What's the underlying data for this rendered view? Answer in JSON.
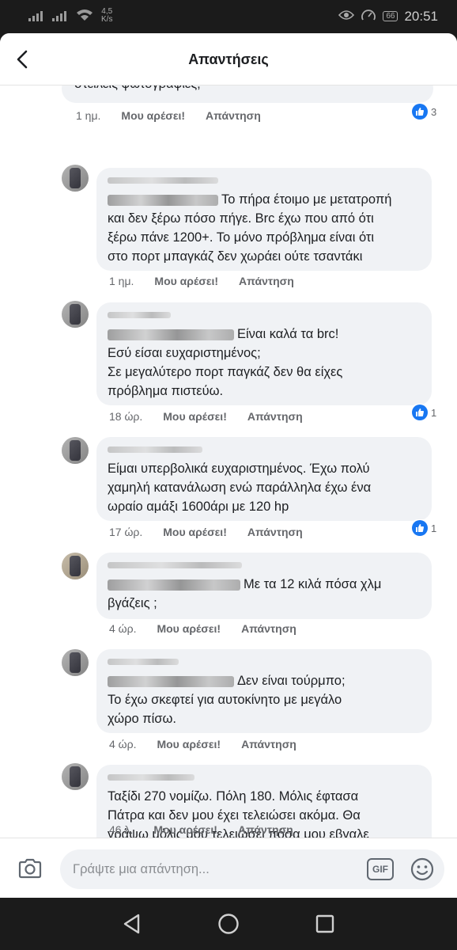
{
  "status_bar": {
    "network_speed_value": "4,5",
    "network_speed_unit": "K/s",
    "battery": "66",
    "time": "20:51",
    "icons": [
      "signal-icon",
      "signal-icon",
      "wifi-icon",
      "eye-icon",
      "speedometer-icon",
      "battery-icon"
    ]
  },
  "header": {
    "title": "Απαντήσεις",
    "back_icon": "back-arrow-icon"
  },
  "actions": {
    "like": "Μου αρέσει!",
    "reply": "Απάντηση"
  },
  "comments": [
    {
      "text_lines": [
        "στείλεις φωτογραφίες;"
      ],
      "time": "1 ημ.",
      "reaction_count": "3"
    },
    {
      "text_lines": [
        "Το πήρα έτοιμο με μετατροπή",
        "και δεν ξέρω πόσο πήγε. Brc έχω που από ότι",
        "ξέρω πάνε 1200+. Το μόνο πρόβλημα είναι ότι",
        "στο πορτ μπαγκάζ δεν χωράει ούτε τσαντάκι"
      ],
      "time": "1 ημ.",
      "reaction_count": ""
    },
    {
      "text_lines": [
        "Είναι καλά τα brc!",
        "Εσύ είσαι ευχαριστημένος;",
        "Σε μεγαλύτερο πορτ παγκάζ δεν θα είχες",
        "πρόβλημα πιστεύω."
      ],
      "time": "18 ώρ.",
      "reaction_count": "1"
    },
    {
      "text_lines": [
        "Είμαι υπερβολικά ευχαριστημένος. Έχω πολύ",
        "χαμηλή κατανάλωση ενώ παράλληλα έχω ένα",
        "ωραίο αμάξι 1600άρι με 120 hp"
      ],
      "time": "17 ώρ.",
      "reaction_count": "1"
    },
    {
      "text_lines": [
        "Με τα 12 κιλά πόσα χλμ",
        "βγάζεις ;"
      ],
      "time": "4 ώρ.",
      "reaction_count": ""
    },
    {
      "text_lines": [
        "Δεν είναι τούρμπο;",
        "Το έχω σκεφτεί για αυτοκίνητο με μεγάλο",
        "χώρο πίσω."
      ],
      "time": "4 ώρ.",
      "reaction_count": ""
    },
    {
      "text_lines": [
        "Ταξίδι 270 νομίζω. Πόλη 180. Μόλις έφτασα",
        "Πάτρα και δεν μου έχει τελειώσει ακόμα. Θα",
        "γράψω μόλις μου τελειώσει πόσα μου εβγαλε"
      ],
      "time": "46 λ.",
      "reaction_count": ""
    }
  ],
  "composer": {
    "placeholder": "Γράψτε μια απάντηση...",
    "gif_label": "GIF",
    "icons": [
      "camera-icon",
      "gif-icon",
      "emoji-icon"
    ]
  },
  "nav": {
    "icons": [
      "back-triangle-icon",
      "home-circle-icon",
      "recents-square-icon"
    ]
  },
  "colors": {
    "accent": "#1877f2",
    "bubble": "#f0f2f5",
    "meta": "#65676b"
  }
}
